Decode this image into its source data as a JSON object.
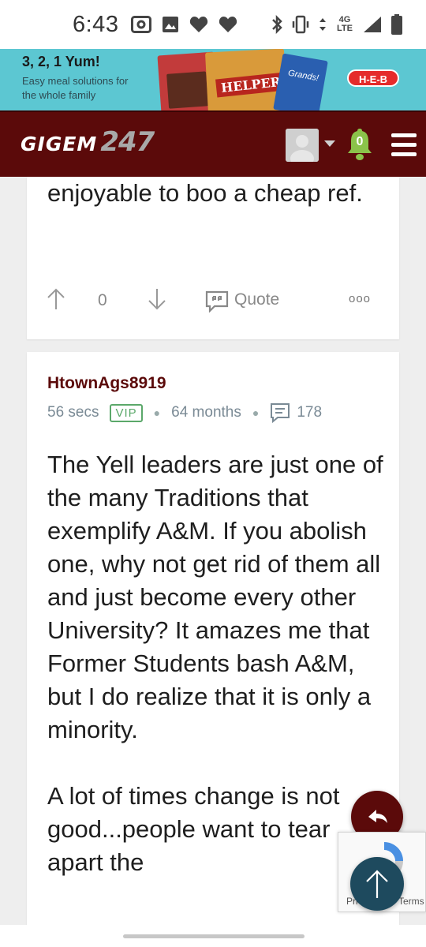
{
  "status_bar": {
    "time": "6:43",
    "network_label": "4G LTE",
    "icons": [
      "cast-icon",
      "image-icon",
      "heart-icon",
      "heart-icon",
      "bluetooth-icon",
      "vibrate-icon",
      "data-arrows-icon",
      "signal-icon",
      "battery-icon"
    ]
  },
  "ad": {
    "title": "3, 2, 1 Yum!",
    "subtitle": "Easy meal solutions for the whole family",
    "product_label": "HELPER",
    "product2_label": "Grands!",
    "brand": "H-E-B"
  },
  "navbar": {
    "logo_text": "GIGEM",
    "logo_number": "247",
    "notification_count": "0",
    "colors": {
      "background": "#5b0a0a",
      "bell": "#8bc34a"
    }
  },
  "previous_post": {
    "text_tail": "enjoyable to boo a cheap ref.",
    "vote_count": "0",
    "quote_label": "Quote",
    "more_label": "ooo"
  },
  "post": {
    "author": "HtownAgs8919",
    "time_ago": "56 secs",
    "badge": "VIP",
    "member_duration": "64 months",
    "post_count": "178",
    "paragraphs": [
      "The Yell leaders are just one of the many Traditions that exemplify A&M. If you abolish one, why not get rid of them all and just become every other University? It amazes me that Former Students bash A&M, but I do realize that it is only a minority.",
      "A lot of times change is not good...people want to tear apart the"
    ]
  },
  "recaptcha": {
    "privacy_label": "Privacy",
    "terms_label": "Terms"
  },
  "colors": {
    "maroon": "#5b0a0a",
    "vip_green": "#5ba86a",
    "meta_gray": "#7a8a95",
    "scroll_top_fab": "#1e4a5e"
  }
}
